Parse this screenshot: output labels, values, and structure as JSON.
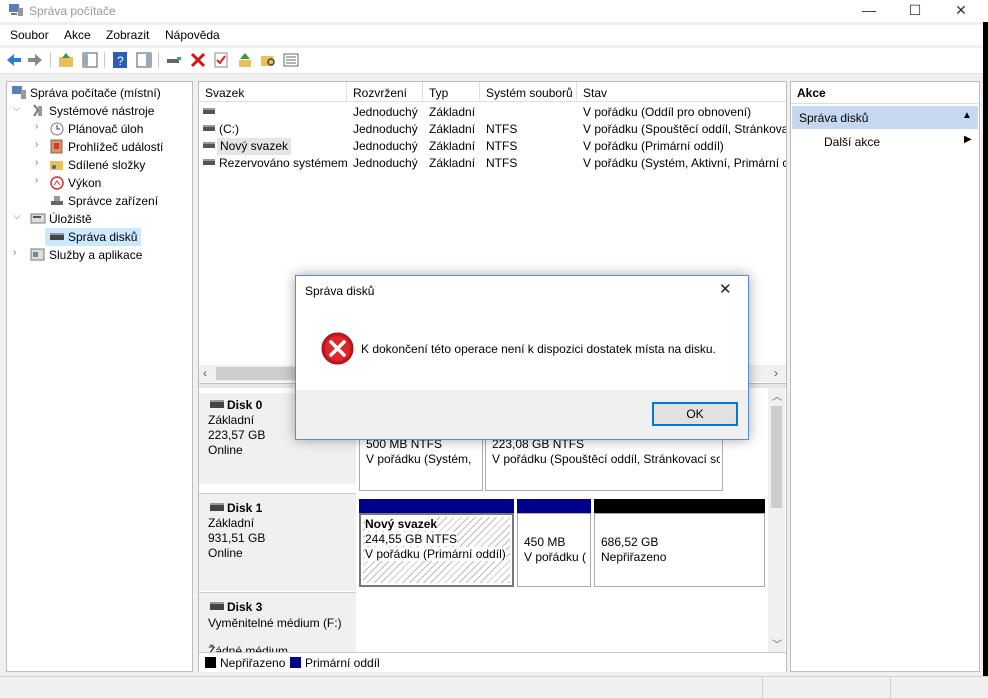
{
  "window": {
    "title": "Správa počítače",
    "min_glyph": "—",
    "max_glyph": "☐",
    "close_glyph": "✕"
  },
  "menu": [
    "Soubor",
    "Akce",
    "Zobrazit",
    "Nápověda"
  ],
  "tree": {
    "root": "Správa počítače (místní)",
    "system_tools": "Systémové nástroje",
    "task_scheduler": "Plánovač úloh",
    "event_viewer": "Prohlížeč událostí",
    "shared_folders": "Sdílené složky",
    "performance": "Výkon",
    "device_manager": "Správce zařízení",
    "storage": "Úložiště",
    "disk_management": "Správa disků",
    "services": "Služby a aplikace"
  },
  "volumes": {
    "columns": [
      "Svazek",
      "Rozvržení",
      "Typ",
      "Systém souborů",
      "Stav"
    ],
    "rows": [
      {
        "name": "",
        "layout": "Jednoduchý",
        "type": "Základní",
        "fs": "",
        "status": "V pořádku (Oddíl pro obnovení)"
      },
      {
        "name": "(C:)",
        "layout": "Jednoduchý",
        "type": "Základní",
        "fs": "NTFS",
        "status": "V pořádku (Spouštěcí oddíl, Stránkovací"
      },
      {
        "name": "Nový svazek",
        "layout": "Jednoduchý",
        "type": "Základní",
        "fs": "NTFS",
        "status": "V pořádku (Primární oddíl)"
      },
      {
        "name": "Rezervováno systémem",
        "layout": "Jednoduchý",
        "type": "Základní",
        "fs": "NTFS",
        "status": "V pořádku (Systém, Aktivní, Primární o"
      }
    ]
  },
  "disks": {
    "disk0": {
      "name": "Disk 0",
      "type": "Základní",
      "size": "223,57 GB",
      "state": "Online",
      "p1_size": "500 MB NTFS",
      "p1_status": "V pořádku (Systém, ",
      "p2_size": "223,08 GB NTFS",
      "p2_status": "V pořádku (Spouštěcí oddíl, Stránkovací sou"
    },
    "disk1": {
      "name": "Disk 1",
      "type": "Základní",
      "size": "931,51 GB",
      "state": "Online",
      "p1_name": "Nový svazek",
      "p1_size": "244,55 GB NTFS",
      "p1_status": "V pořádku (Primární oddíl)",
      "p2_size": "450 MB",
      "p2_status": "V pořádku (",
      "p3_size": "686,52 GB",
      "p3_status": "Nepřiřazeno"
    },
    "disk3": {
      "name": "Disk 3",
      "type": "Vyměnitelné médium (F:)",
      "extra": "Žádné médium"
    }
  },
  "legend": {
    "unallocated": "Nepřiřazeno",
    "primary": "Primární oddíl",
    "unallocated_color": "#000000",
    "primary_color": "#00008b"
  },
  "actions": {
    "header": "Akce",
    "section": "Správa disků",
    "more": "Další akce"
  },
  "dialog": {
    "title": "Správa disků",
    "message": "K dokončení této operace není k dispozici dostatek místa na disku.",
    "ok": "OK"
  }
}
